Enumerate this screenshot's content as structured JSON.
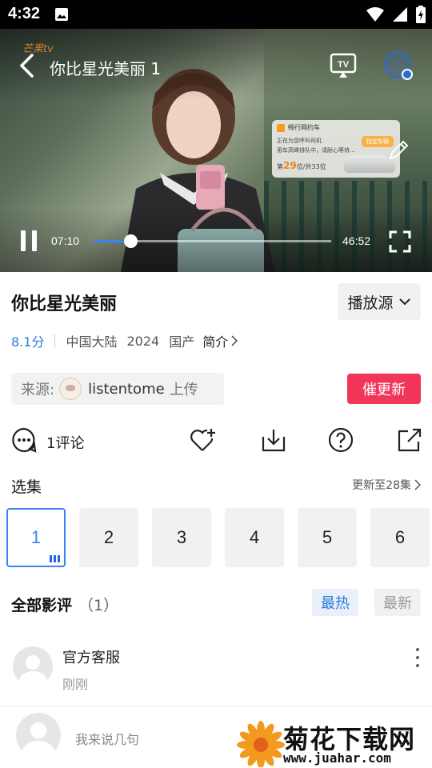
{
  "status_bar": {
    "time": "4:32"
  },
  "player": {
    "watermark": "芒果tv",
    "title": "你比星光美丽 1",
    "current_time": "07:10",
    "total_time": "46:52",
    "progress_fraction": 0.152
  },
  "ad": {
    "brand": "畅行网约车",
    "line1": "正在为您呼叫司机",
    "line2": "用车高峰排队中，请耐心等待...",
    "button": "指定车辆",
    "rank_prefix": "第",
    "rank_num": "29",
    "rank_suffix": "位/共33位"
  },
  "show": {
    "title": "你比星光美丽",
    "source_button": "播放源",
    "score": "8.1分",
    "region": "中国大陆",
    "year": "2024",
    "category": "国产",
    "intro": "简介"
  },
  "uploader": {
    "label": "来源:",
    "name": "listentome",
    "action": "上传",
    "urge_button": "催更新"
  },
  "actions": {
    "comment_label": "1评论"
  },
  "episodes": {
    "title": "选集",
    "more": "更新至28集",
    "items": [
      "1",
      "2",
      "3",
      "4",
      "5",
      "6"
    ],
    "active_index": 0
  },
  "reviews": {
    "title": "全部影评",
    "count": "（1）",
    "tab_hot": "最热",
    "tab_new": "最新",
    "comments": [
      {
        "name": "官方客服",
        "time": "刚刚"
      }
    ]
  },
  "input": {
    "placeholder": "我来说几句"
  },
  "site_watermark": {
    "name": "菊花下载网",
    "url": "www.juahar.com"
  },
  "colors": {
    "accent": "#3b82f6",
    "urge": "#f2365a",
    "score": "#2b7bd8"
  }
}
